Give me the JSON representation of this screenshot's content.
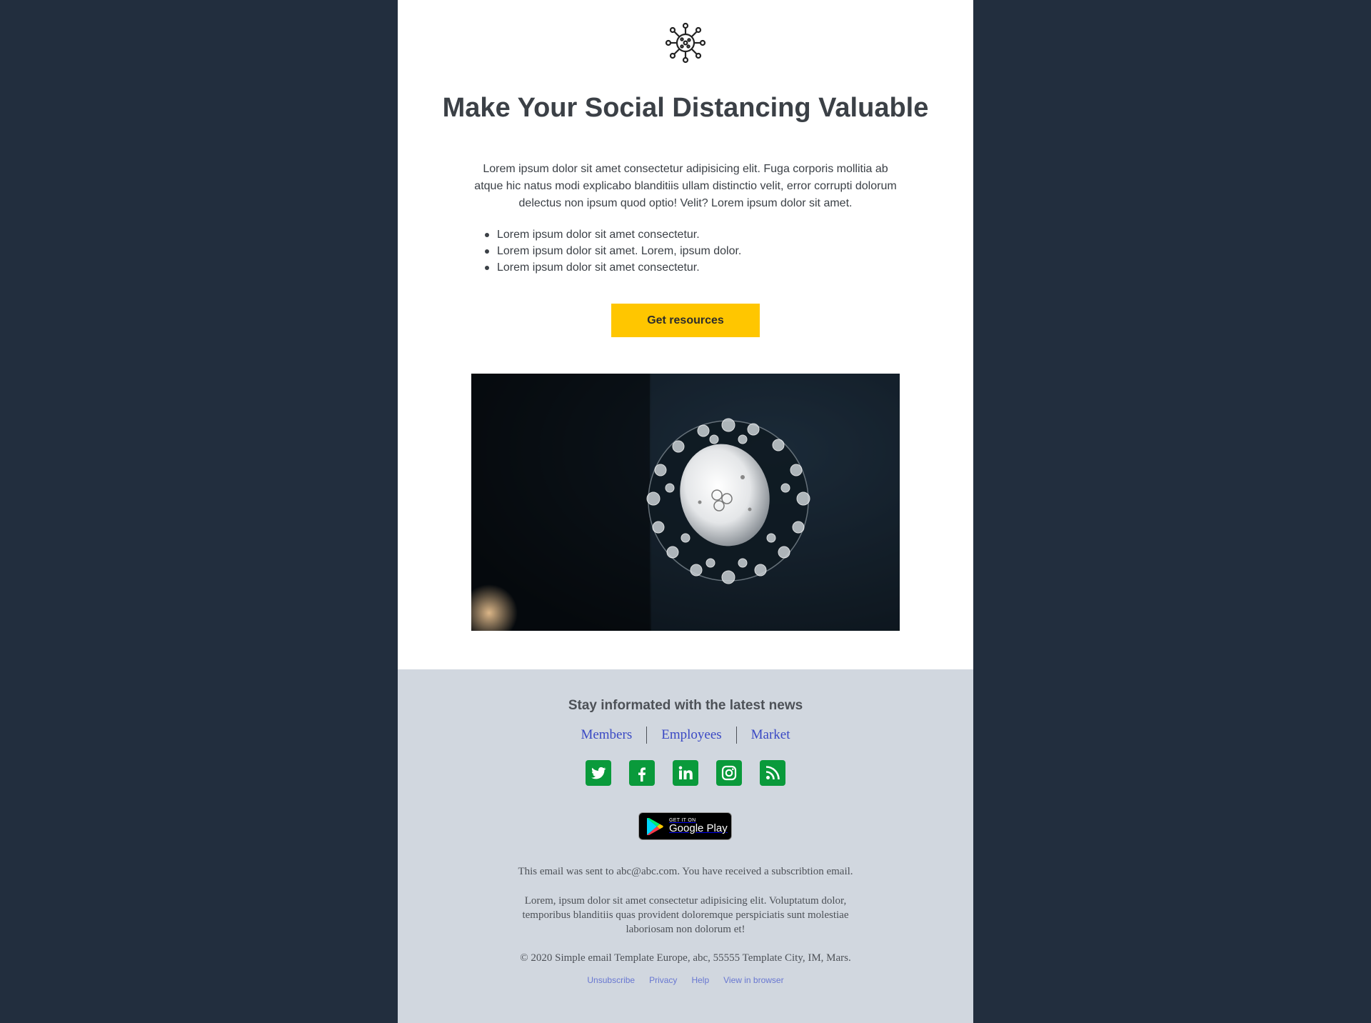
{
  "header": {
    "logo_icon": "virus-icon",
    "title": "Make Your Social Distancing Valuable"
  },
  "content": {
    "intro": "Lorem ipsum dolor sit amet consectetur adipisicing elit. Fuga corporis mollitia ab atque hic natus modi explicabo blanditiis ullam distinctio velit, error corrupti dolorum delectus non ipsum quod optio! Velit? Lorem ipsum dolor sit amet.",
    "bullets": [
      "Lorem ipsum dolor sit amet consectetur.",
      "Lorem ipsum dolor sit amet. Lorem, ipsum dolor.",
      "Lorem ipsum dolor sit amet consectetur."
    ],
    "cta_label": "Get resources",
    "cta_color": "#ffc600",
    "hero_image": "virus-sculpture-photo"
  },
  "footer": {
    "heading": "Stay informated with the latest news",
    "links": [
      "Members",
      "Employees",
      "Market"
    ],
    "social_icons": [
      "twitter-icon",
      "facebook-icon",
      "linkedin-icon",
      "instagram-icon",
      "rss-icon"
    ],
    "social_color": "#0a9a3b",
    "store_badge": {
      "small": "GET IT ON",
      "big": "Google Play"
    },
    "sent_to": "This email was sent to abc@abc.com. You have received a subscribtion email.",
    "body": "Lorem, ipsum dolor sit amet consectetur adipisicing elit. Voluptatum dolor, temporibus blanditiis quas provident doloremque perspiciatis sunt molestiae laboriosam non dolorum et!",
    "copyright": "© 2020 Simple email Template Europe, abc, 55555 Template City, IM, Mars.",
    "legal_links": [
      "Unsubscribe",
      "Privacy",
      "Help",
      "View in browser"
    ]
  }
}
